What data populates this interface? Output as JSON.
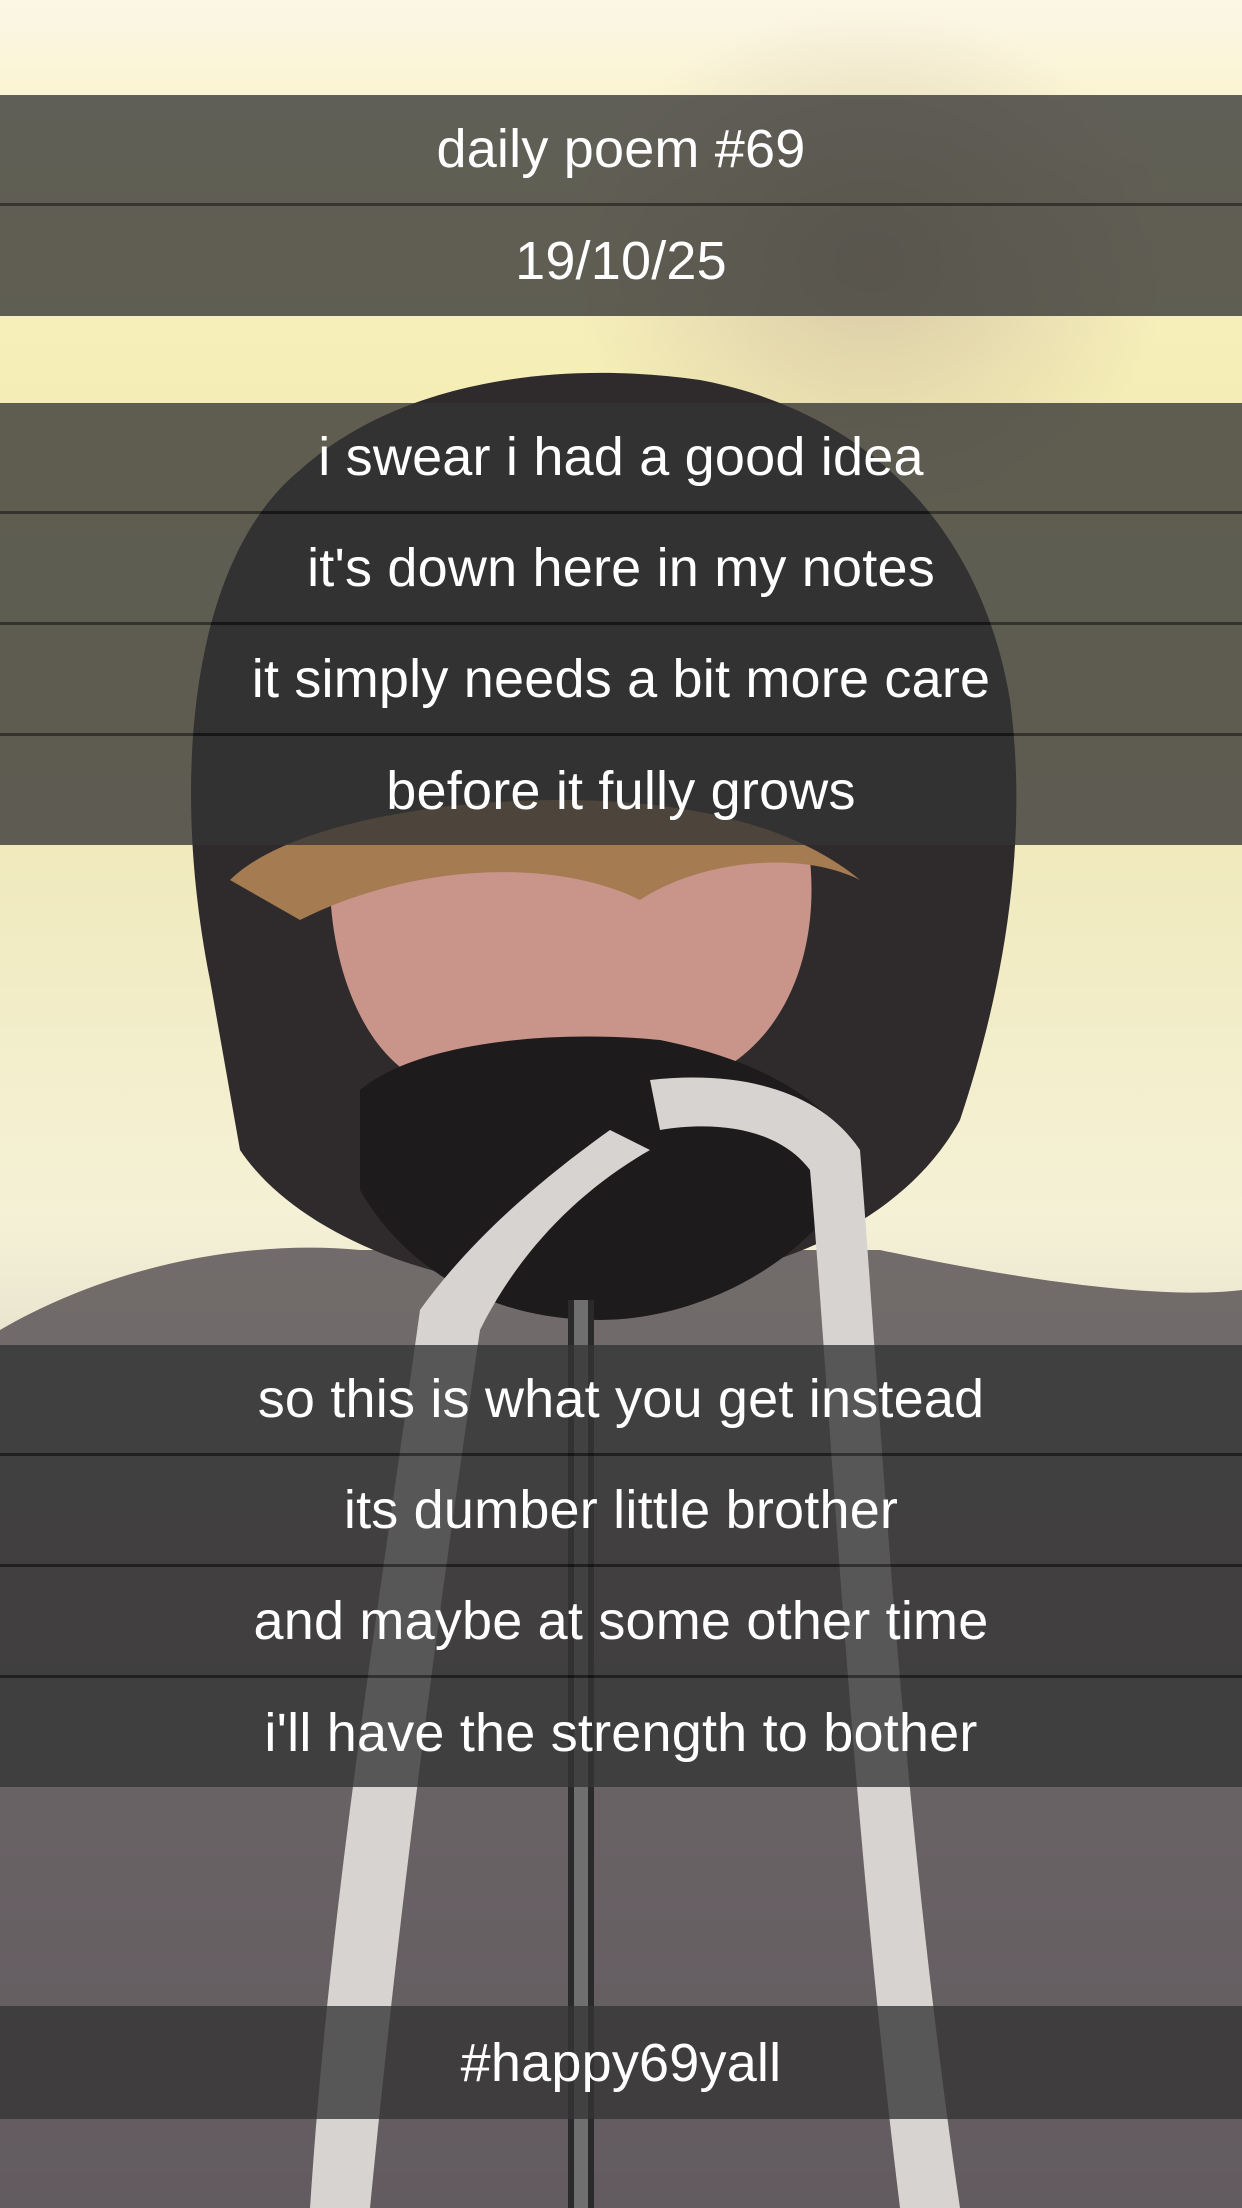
{
  "header": {
    "title": "daily poem #69",
    "date": "19/10/25"
  },
  "poem": {
    "stanza_1": [
      "i swear i had a good idea",
      "it's down here in my notes",
      "it simply needs a bit more care",
      "before it fully grows"
    ],
    "stanza_2": [
      "so this is what you get instead",
      "its dumber little brother",
      "and maybe at some other time",
      "i'll have the strength to bother"
    ]
  },
  "footer": {
    "hashtag": "#happy69yall"
  },
  "colors": {
    "band": "#343434",
    "text": "#ffffff",
    "background_warm": "#fbf3c4"
  }
}
